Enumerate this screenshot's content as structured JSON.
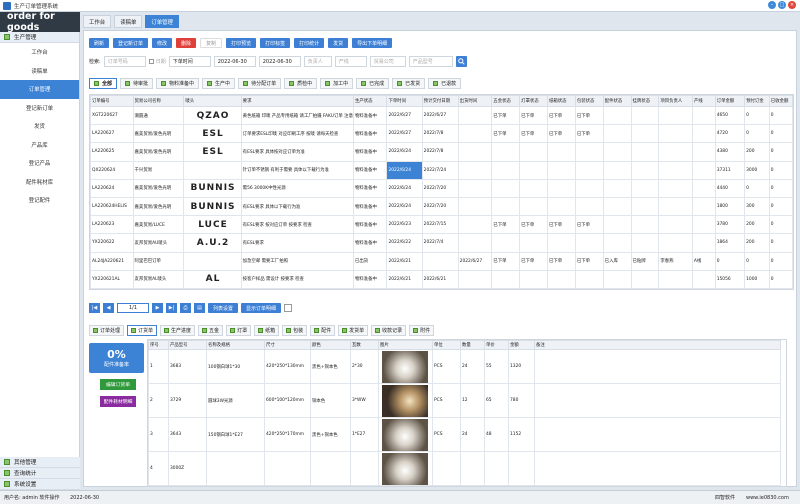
{
  "window": {
    "title": "生产订单管理系统"
  },
  "brand": "order for goods",
  "sidebar": {
    "group": "生产管理",
    "items": [
      "工作台",
      "读稿单",
      "订单管理",
      "登记新订单",
      "发货",
      "产品库",
      "登记产品",
      "配件耗材库",
      "登记配件"
    ],
    "bottom": [
      "其他管理",
      "查询统计",
      "系统设置"
    ]
  },
  "tabs": [
    "工作台",
    "读稿单",
    "订单管理"
  ],
  "toolbar": [
    "刷新",
    "登记新订单",
    "修改",
    "删除",
    "复制",
    "打印预览",
    "打印标签",
    "打印统计",
    "发货",
    "导出下单明细"
  ],
  "filter": {
    "search_label": "检索:",
    "search_placeholder": "订单号码",
    "date_checkbox": "日期",
    "date_field": "下单时间",
    "date_from": "2022-06-30",
    "date_to": "2022-06-30",
    "person_ph": "负责人",
    "product_ph": "产线",
    "company_ph": "贸易公司",
    "model_ph": "产品型号"
  },
  "status_tabs": [
    "全部",
    "待审批",
    "物料准备中",
    "生产中",
    "待分配订单",
    "质检中",
    "加工中",
    "已完成",
    "已发货",
    "已退款"
  ],
  "grid": {
    "columns": [
      "订单编号",
      "贸易公司名称",
      "唛头",
      "要求",
      "生产状态",
      "下单时间",
      "预计交付日期",
      "出货时间",
      "五金状态",
      "灯罩状态",
      "纸箱状态",
      "包装状态",
      "配件状态",
      "挂牌状态",
      "项目负责人",
      "产线",
      "订单金额",
      "预付订金",
      "已收金额"
    ],
    "rows": [
      [
        "XGT220627",
        "潮圆通",
        "QZAO",
        "黄色纸箱 印唛 产品专用纸箱 请工厂拍摄 FAKU订单 注意",
        "物料准备中",
        "2022/6/27",
        "2022/6/27",
        "",
        "已下单",
        "已下单",
        "已下单",
        "已下单",
        "",
        "",
        "",
        "",
        "4650",
        "0",
        "0"
      ],
      [
        "LA220627",
        "嘉美贸易/爱色光明",
        "ESL",
        "订单要求ESL印唛 对应印刷工序 按唛 请每天检查",
        "物料准备中",
        "2022/6/27",
        "2022/7/8",
        "",
        "已下单",
        "已下单",
        "已下单",
        "已下单",
        "",
        "",
        "",
        "",
        "4720",
        "0",
        "0"
      ],
      [
        "LA220625",
        "嘉美贸易/爱色光明",
        "ESL",
        "有ESL要求 具体按对应订单为准",
        "物料准备中",
        "2022/6/24",
        "2022/7/8",
        "",
        "",
        "",
        "",
        "",
        "",
        "",
        "",
        "",
        "4380",
        "200",
        "0"
      ],
      [
        "QX220624",
        "千兴贸易",
        "",
        "针订单不锈钢 有利于需要 具体以下载行为准",
        "物料准备中",
        "2022/6/24",
        "2022/7/24",
        "",
        "",
        "",
        "",
        "",
        "",
        "",
        "",
        "",
        "37311",
        "3000",
        "0"
      ],
      [
        "LA220624",
        "嘉美贸易/爱色光明",
        "BUNNIS",
        "需56 3000K中性光源",
        "物料准备中",
        "2022/6/24",
        "2022/7/20",
        "",
        "",
        "",
        "",
        "",
        "",
        "",
        "",
        "",
        "4440",
        "0",
        "0"
      ],
      [
        "LA220624HELIS",
        "嘉美贸易/爱色光明",
        "BUNNIS",
        "有ESL要求 具体以下载行为准",
        "物料准备中",
        "2022/6/24",
        "2022/7/20",
        "",
        "",
        "",
        "",
        "",
        "",
        "",
        "",
        "",
        "1800",
        "300",
        "0"
      ],
      [
        "LA220623",
        "嘉美贸易/LUCE",
        "LUCE",
        "有ESL要求 按对应订单 按要求 检查",
        "物料准备中",
        "2022/6/23",
        "2022/7/15",
        "",
        "已下单",
        "已下单",
        "已下单",
        "已下单",
        "",
        "",
        "",
        "",
        "3780",
        "200",
        "0"
      ],
      [
        "YX220622",
        "友邦贸易AU唛头",
        "A.U.2",
        "有ESL要求",
        "物料准备中",
        "2022/6/22",
        "2022/7/4",
        "",
        "",
        "",
        "",
        "",
        "",
        "",
        "",
        "",
        "1864",
        "200",
        "0"
      ],
      [
        "AL24JA220621",
        "阿里巴巴订单",
        "",
        "加急空邮 需要工厂拍照",
        "已出货",
        "2022/6/21",
        "",
        "2022/6/27",
        "已下单",
        "已下单",
        "已下单",
        "已下单",
        "已入库",
        "已贴牌",
        "李春燕",
        "A线",
        "0",
        "0",
        "0"
      ],
      [
        "YX220621AL",
        "友邦贸易AL唛头",
        "AL",
        "按客户样品 需设计 按要求 检查",
        "物料准备中",
        "2022/6/21",
        "2022/6/21",
        "",
        "",
        "",
        "",
        "",
        "",
        "",
        "",
        "",
        "15056",
        "1000",
        "0"
      ]
    ]
  },
  "pager": {
    "text": "1/1",
    "select_label": "列表设置",
    "toggle_label": "显示订单明细"
  },
  "bottom_tabs": [
    "订单处理",
    "订货单",
    "生产进度",
    "五金",
    "灯罩",
    "纸箱",
    "包装",
    "配件",
    "发货单",
    "收款记录",
    "附件"
  ],
  "progress": {
    "percent": "0%",
    "label": "配件准备率"
  },
  "actions": {
    "edit": "编辑订货单",
    "material": "配件耗材明细"
  },
  "detail": {
    "columns": [
      "序号",
      "产品型号",
      "名称及规格",
      "尺寸",
      "颜色",
      "瓦数",
      "图片",
      "单位",
      "数量",
      "单价",
      "金额",
      "备注"
    ],
    "rows": [
      [
        "1",
        "3683",
        "100钢白球1*30",
        "420*250*130mm",
        "黑色+铜本色",
        "2*30",
        "",
        "PCS",
        "24",
        "55",
        "1320",
        ""
      ],
      [
        "2",
        "3729",
        "圆球3W光源",
        "600*100*120mm",
        "铜本色",
        "3*WW",
        "",
        "PCS",
        "12",
        "65",
        "780",
        ""
      ],
      [
        "3",
        "3643",
        "150钢白球1*E27",
        "420*250*170mm",
        "黑色+铜本色",
        "1*E27",
        "",
        "PCS",
        "24",
        "48",
        "1152",
        ""
      ],
      [
        "4",
        "3000Z",
        "",
        "",
        "",
        "",
        "",
        "",
        "",
        "",
        "",
        ""
      ]
    ]
  },
  "status": {
    "user": "用户名: admin 软件操作",
    "date": "2022-06-30",
    "vendor": "四智软件",
    "site": "www.ie0830.com"
  }
}
